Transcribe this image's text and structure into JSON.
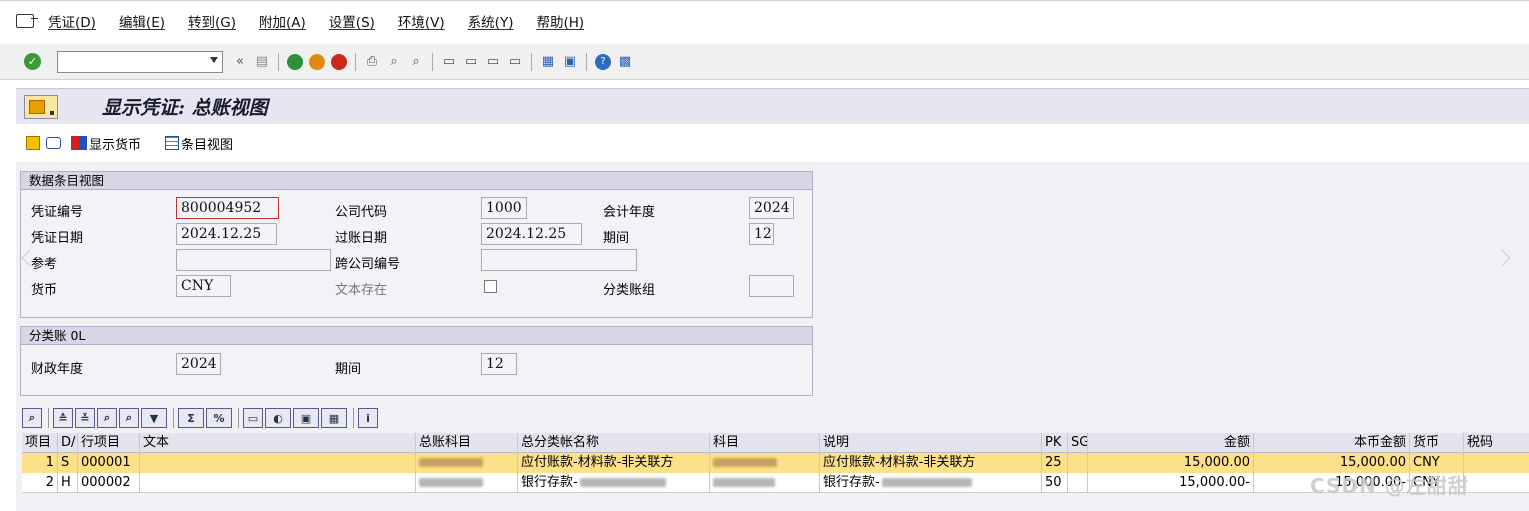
{
  "menu": {
    "items": [
      {
        "label": "凭证(D)"
      },
      {
        "label": "编辑(E)"
      },
      {
        "label": "转到(G)"
      },
      {
        "label": "附加(A)"
      },
      {
        "label": "设置(S)"
      },
      {
        "label": "环境(V)"
      },
      {
        "label": "系统(Y)"
      },
      {
        "label": "帮助(H)"
      }
    ]
  },
  "toolbar": {
    "command_value": "",
    "back_label": "«"
  },
  "header": {
    "title": "显示凭证: 总账视图"
  },
  "appbar": {
    "currency_label": "显示货币",
    "entry_view_label": "条目视图"
  },
  "panel_data_entry": {
    "title": "数据条目视图",
    "doc_no_label": "凭证编号",
    "doc_no": "800004952",
    "company_label": "公司代码",
    "company": "1000",
    "fiscal_year_label": "会计年度",
    "fiscal_year": "2024",
    "doc_date_label": "凭证日期",
    "doc_date": "2024.12.25",
    "posting_date_label": "过账日期",
    "posting_date": "2024.12.25",
    "period_label": "期间",
    "period": "12",
    "reference_label": "参考",
    "reference": "",
    "intercompany_label": "跨公司编号",
    "intercompany": "",
    "currency_label": "货币",
    "currency": "CNY",
    "text_exists_label": "文本存在",
    "ledger_group_label": "分类账组",
    "ledger_group": ""
  },
  "panel_ledger": {
    "title": "分类账 0L",
    "fiscal_year_label": "财政年度",
    "fiscal_year": "2024",
    "period_label": "期间",
    "period": "12"
  },
  "grid": {
    "headers": [
      "项目",
      "D/",
      "行项目",
      "文本",
      "总账科目",
      "总分类帐名称",
      "科目",
      "说明",
      "PK",
      "SG",
      "金额",
      "本币金额",
      "货币",
      "税码"
    ],
    "rows": [
      {
        "item": "1",
        "dc": "S",
        "line": "000001",
        "text": "",
        "gl_name": "应付账款-材料款-非关联方",
        "desc": "应付账款-材料款-非关联方",
        "pk": "25",
        "sg": "",
        "amount": "15,000.00",
        "local_amount": "15,000.00",
        "currency": "CNY",
        "tax": ""
      },
      {
        "item": "2",
        "dc": "H",
        "line": "000002",
        "text": "",
        "gl_name": "银行存款-",
        "desc": "银行存款-",
        "pk": "50",
        "sg": "",
        "amount": "15,000.00-",
        "local_amount": "15,000.00-",
        "currency": "CNY",
        "tax": ""
      }
    ]
  },
  "watermark": "CSDN @左甜甜"
}
